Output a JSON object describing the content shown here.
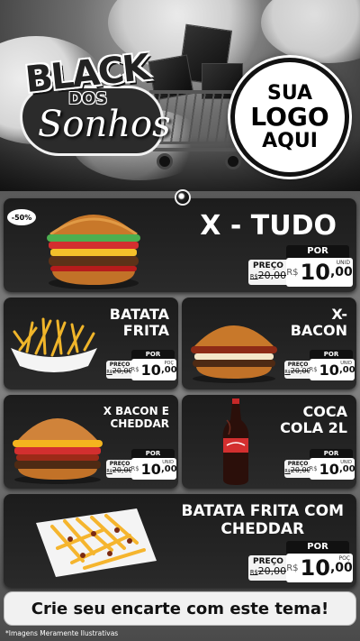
{
  "header": {
    "brand_line1": "BLACK",
    "brand_line2": "DOS",
    "brand_line3": "Sonhos",
    "logo_line1": "SUA",
    "logo_line2": "LOGO",
    "logo_line3": "AQUI"
  },
  "products": {
    "xtudo": {
      "badge": "-50%",
      "title": "X - TUDO",
      "por_label": "POR",
      "preco_label": "PREÇO",
      "old_price": "20,00",
      "currency": "R$",
      "price_int": "10",
      "price_dec": ",00",
      "unit": "UNID"
    },
    "batata": {
      "title_line1": "BATATA",
      "title_line2": "FRITA",
      "por_label": "POR",
      "preco_label": "PREÇO",
      "old_price": "20,00",
      "currency": "R$",
      "price_int": "10",
      "price_dec": ",00",
      "unit": "POÇ"
    },
    "xbacon": {
      "title_line1": "X-",
      "title_line2": "BACON",
      "por_label": "POR",
      "preco_label": "PREÇO",
      "old_price": "20,00",
      "currency": "R$",
      "price_int": "10",
      "price_dec": ",00",
      "unit": "UNID"
    },
    "xbaconcheddar": {
      "title_line1": "X BACON E",
      "title_line2": "CHEDDAR",
      "por_label": "POR",
      "preco_label": "PREÇO",
      "old_price": "20,00",
      "currency": "R$",
      "price_int": "10",
      "price_dec": ",00",
      "unit": "UNID"
    },
    "coca": {
      "title_line1": "COCA",
      "title_line2": "COLA 2L",
      "por_label": "POR",
      "preco_label": "PREÇO",
      "old_price": "20,00",
      "currency": "R$",
      "price_int": "10",
      "price_dec": ",00",
      "unit": "UNID"
    },
    "batatacheddar": {
      "title_line1": "BATATA FRITA COM",
      "title_line2": "CHEDDAR",
      "por_label": "POR",
      "preco_label": "PREÇO",
      "old_price": "20,00",
      "currency": "R$",
      "price_int": "10",
      "price_dec": ",00",
      "unit": "POÇ"
    }
  },
  "banner_text": "Crie seu encarte com este tema!",
  "disclaimer": "*Imagens Meramente Ilustrativas"
}
